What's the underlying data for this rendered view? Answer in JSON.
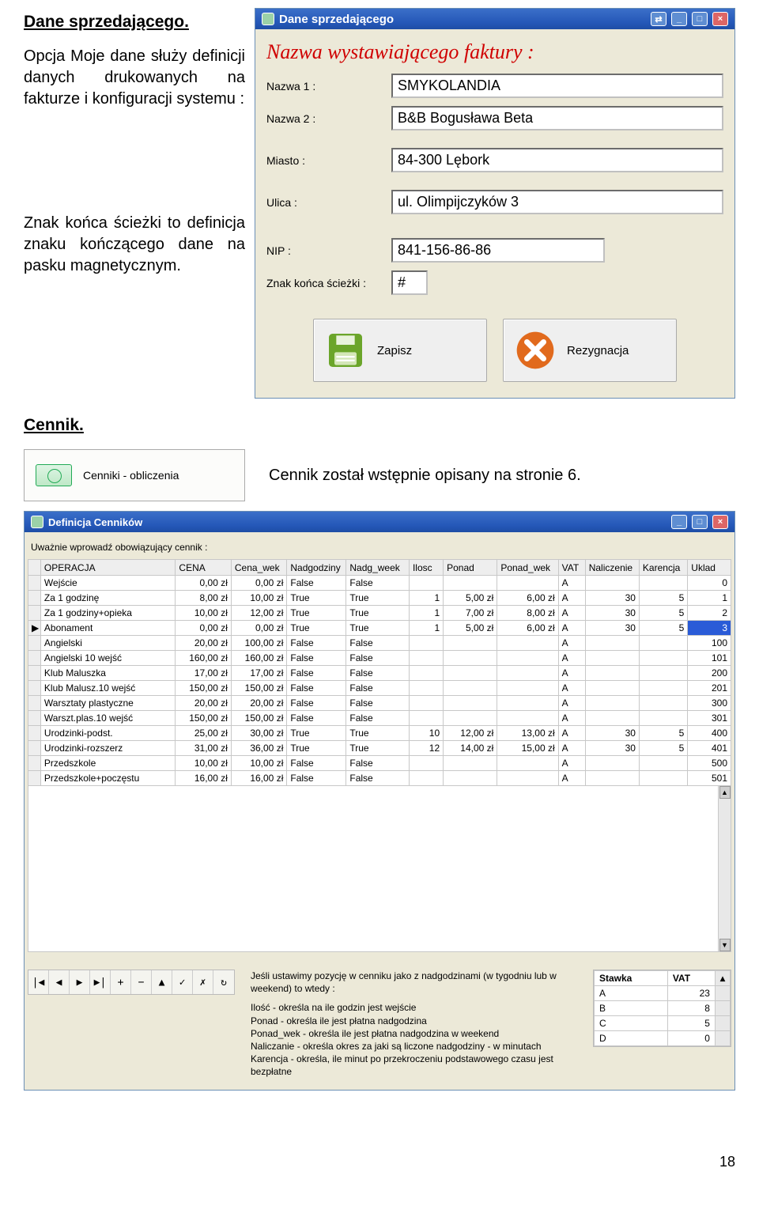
{
  "doc": {
    "heading1": "Dane sprzedającego.",
    "para1": "Opcja Moje dane służy definicji danych drukowanych na fakturze i konfiguracji systemu :",
    "para2": "Znak końca ścieżki to definicja znaku kończącego dane na pasku magnetycznym.",
    "heading2": "Cennik.",
    "cennik_btn_label": "Cenniki - obliczenia",
    "cennik_note": "Cennik został wstępnie opisany na stronie 6.",
    "page_num": "18"
  },
  "win1": {
    "title": "Dane sprzedającego",
    "nazwa_header": "Nazwa wystawiającego faktury :",
    "labels": {
      "nazwa1": "Nazwa 1 :",
      "nazwa2": "Nazwa 2 :",
      "miasto": "Miasto :",
      "ulica": "Ulica :",
      "nip": "NIP :",
      "znak": "Znak końca ścieżki :"
    },
    "values": {
      "nazwa1": "SMYKOLANDIA",
      "nazwa2": "B&B Bogusława Beta",
      "miasto": "84-300 Lębork",
      "ulica": "ul. Olimpijczyków 3",
      "nip": "841-156-86-86",
      "znak": "#"
    },
    "buttons": {
      "zapisz": "Zapisz",
      "rezygnacja": "Rezygnacja"
    }
  },
  "win2": {
    "title": "Definicja Cenników",
    "instr": "Uważnie wprowadź obowiązujący cennik :",
    "headers": [
      "",
      "OPERACJA",
      "CENA",
      "Cena_wek",
      "Nadgodziny",
      "Nadg_week",
      "Ilosc",
      "Ponad",
      "Ponad_wek",
      "VAT",
      "Naliczenie",
      "Karencja",
      "Uklad"
    ],
    "rows": [
      [
        "",
        "Wejście",
        "0,00 zł",
        "0,00 zł",
        "False",
        "False",
        "",
        "",
        "",
        "A",
        "",
        "",
        "0"
      ],
      [
        "",
        "Za 1 godzinę",
        "8,00 zł",
        "10,00 zł",
        "True",
        "True",
        "1",
        "5,00 zł",
        "6,00 zł",
        "A",
        "30",
        "5",
        "1"
      ],
      [
        "",
        "Za 1 godziny+opieka",
        "10,00 zł",
        "12,00 zł",
        "True",
        "True",
        "1",
        "7,00 zł",
        "8,00 zł",
        "A",
        "30",
        "5",
        "2"
      ],
      [
        "▶",
        "Abonament",
        "0,00 zł",
        "0,00 zł",
        "True",
        "True",
        "1",
        "5,00 zł",
        "6,00 zł",
        "A",
        "30",
        "5",
        "3"
      ],
      [
        "",
        "Angielski",
        "20,00 zł",
        "100,00 zł",
        "False",
        "False",
        "",
        "",
        "",
        "A",
        "",
        "",
        "100"
      ],
      [
        "",
        "Angielski 10 wejść",
        "160,00 zł",
        "160,00 zł",
        "False",
        "False",
        "",
        "",
        "",
        "A",
        "",
        "",
        "101"
      ],
      [
        "",
        "Klub Maluszka",
        "17,00 zł",
        "17,00 zł",
        "False",
        "False",
        "",
        "",
        "",
        "A",
        "",
        "",
        "200"
      ],
      [
        "",
        "Klub Malusz.10 wejść",
        "150,00 zł",
        "150,00 zł",
        "False",
        "False",
        "",
        "",
        "",
        "A",
        "",
        "",
        "201"
      ],
      [
        "",
        "Warsztaty plastyczne",
        "20,00 zł",
        "20,00 zł",
        "False",
        "False",
        "",
        "",
        "",
        "A",
        "",
        "",
        "300"
      ],
      [
        "",
        "Warszt.plas.10 wejść",
        "150,00 zł",
        "150,00 zł",
        "False",
        "False",
        "",
        "",
        "",
        "A",
        "",
        "",
        "301"
      ],
      [
        "",
        "Urodzinki-podst.",
        "25,00 zł",
        "30,00 zł",
        "True",
        "True",
        "10",
        "12,00 zł",
        "13,00 zł",
        "A",
        "30",
        "5",
        "400"
      ],
      [
        "",
        "Urodzinki-rozszerz",
        "31,00 zł",
        "36,00 zł",
        "True",
        "True",
        "12",
        "14,00 zł",
        "15,00 zł",
        "A",
        "30",
        "5",
        "401"
      ],
      [
        "",
        "Przedszkole",
        "10,00 zł",
        "10,00 zł",
        "False",
        "False",
        "",
        "",
        "",
        "A",
        "",
        "",
        "500"
      ],
      [
        "",
        "Przedszkole+poczęstu",
        "16,00 zł",
        "16,00 zł",
        "False",
        "False",
        "",
        "",
        "",
        "A",
        "",
        "",
        "501"
      ]
    ],
    "help_title": "Jeśli ustawimy pozycję w cenniku jako z nadgodzinami (w tygodniu lub w weekend) to wtedy :",
    "help_lines": [
      "Ilość - określa na ile godzin jest wejście",
      "Ponad - określa ile jest płatna nadgodzina",
      "Ponad_wek - określa ile jest płatna nadgodzina w weekend",
      "Naliczanie - określa okres za jaki są liczone nadgodziny - w minutach",
      "Karencja - określa, ile minut po przekroczeniu podstawowego czasu jest bezpłatne"
    ],
    "vat_header": [
      "Stawka",
      "VAT"
    ],
    "vat_rows": [
      [
        "A",
        "23"
      ],
      [
        "B",
        "8"
      ],
      [
        "C",
        "5"
      ],
      [
        "D",
        "0"
      ]
    ],
    "nav": [
      "|◀",
      "◀",
      "▶",
      "▶|",
      "+",
      "−",
      "▲",
      "✓",
      "✗",
      "↻"
    ]
  }
}
